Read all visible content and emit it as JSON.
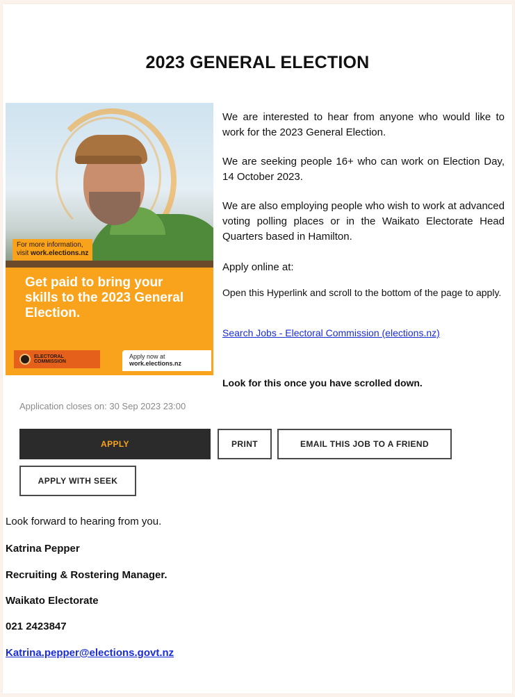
{
  "title": "2023 GENERAL ELECTION",
  "promo": {
    "info_line1": "For more information,",
    "info_line2_prefix": "visit ",
    "info_url": "work.elections.nz",
    "tagline": "Get paid to bring your skills to the 2023 General Election.",
    "logo_text": "ELECTORAL COMMISSION",
    "apply_now_line1": "Apply now at",
    "apply_now_url": "work.elections.nz",
    "colors": {
      "orange": "#f8a31b",
      "logo_orange": "#e5611b"
    }
  },
  "body": {
    "p1": "We are interested to hear from anyone who would like to work for the 2023 General Election.",
    "p2": "We are seeking people 16+ who can work on Election Day, 14 October 2023.",
    "p3": "We are also employing people who wish to work at advanced voting polling places or in the Waikato Electorate Head Quarters based in Hamilton.",
    "p4": "Apply online at:",
    "p5": "Open this Hyperlink and scroll to the bottom of the page to apply.",
    "link": "Search Jobs - Electoral Commission (elections.nz)",
    "p7": "Look for this once you have scrolled down."
  },
  "job": {
    "closes": "Application closes on: 30 Sep 2023 23:00",
    "apply_label": "APPLY",
    "print_label": "PRINT",
    "email_label": "EMAIL THIS JOB TO A FRIEND",
    "seek_label": "APPLY WITH SEEK"
  },
  "signature": {
    "closing": "Look forward to hearing from you.",
    "name": "Katrina Pepper",
    "role": "Recruiting & Rostering Manager.",
    "org": "Waikato Electorate",
    "phone": "021 2423847",
    "email": "Katrina.pepper@elections.govt.nz"
  }
}
